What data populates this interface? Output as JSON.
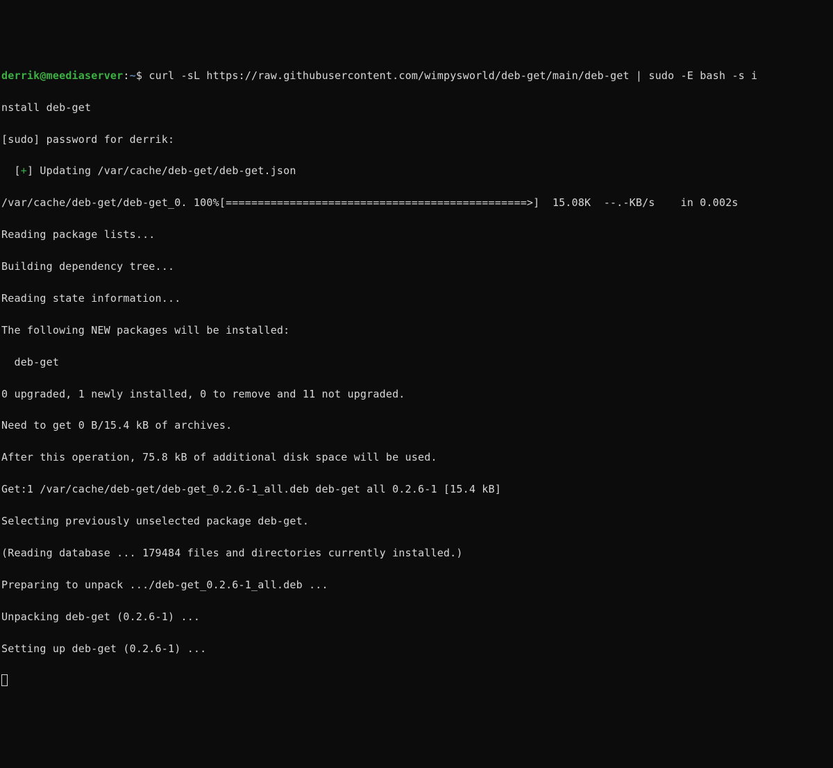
{
  "prompt": {
    "user": "derrik",
    "at": "@",
    "host": "meediaserver",
    "colon": ":",
    "tilde": "~",
    "dollar": "$ ",
    "command": "curl -sL https://raw.githubusercontent.com/wimpysworld/deb-get/main/deb-get | sudo -E bash -s i"
  },
  "lines": {
    "l1": "nstall deb-get",
    "l2": "[sudo] password for derrik:",
    "l3a": "  [",
    "l3plus": "+",
    "l3b": "] Updating /var/cache/deb-get/deb-get.json",
    "l4": "/var/cache/deb-get/deb-get_0. 100%[===============================================>]  15.08K  --.-KB/s    in 0.002s",
    "l5": "Reading package lists...",
    "l6": "Building dependency tree...",
    "l7": "Reading state information...",
    "l8": "The following NEW packages will be installed:",
    "l9": "  deb-get",
    "l10": "0 upgraded, 1 newly installed, 0 to remove and 11 not upgraded.",
    "l11": "Need to get 0 B/15.4 kB of archives.",
    "l12": "After this operation, 75.8 kB of additional disk space will be used.",
    "l13": "Get:1 /var/cache/deb-get/deb-get_0.2.6-1_all.deb deb-get all 0.2.6-1 [15.4 kB]",
    "l14": "Selecting previously unselected package deb-get.",
    "l15": "(Reading database ... 179484 files and directories currently installed.)",
    "l16": "Preparing to unpack .../deb-get_0.2.6-1_all.deb ...",
    "l17": "Unpacking deb-get (0.2.6-1) ...",
    "l18": "Setting up deb-get (0.2.6-1) ..."
  }
}
